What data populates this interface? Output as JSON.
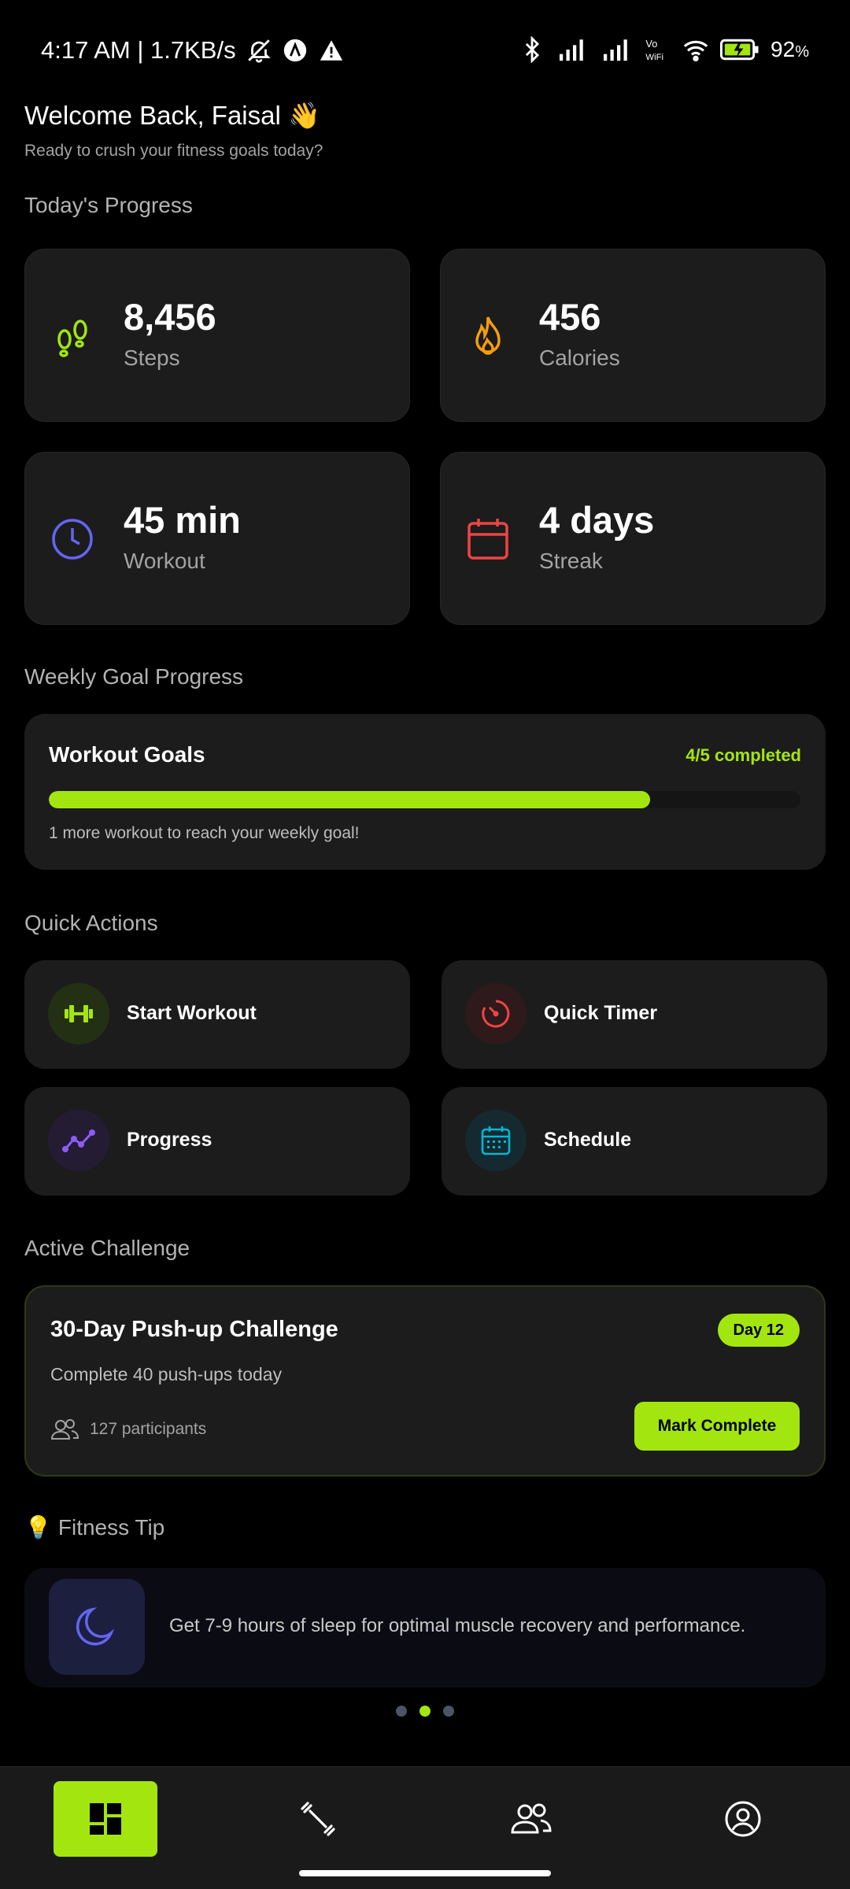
{
  "status_bar": {
    "time_speed": "4:17 AM | 1.7KB/s",
    "battery": "92",
    "battery_unit": "%"
  },
  "greeting": {
    "title": "Welcome Back, Faisal 👋",
    "subtitle": "Ready to crush your fitness goals today?"
  },
  "today": {
    "section_title": "Today's Progress",
    "stats": [
      {
        "value": "8,456",
        "label": "Steps",
        "icon": "footsteps-icon",
        "color": "#a3e60f"
      },
      {
        "value": "456",
        "label": "Calories",
        "icon": "flame-icon",
        "color": "#f59e0b"
      },
      {
        "value": "45 min",
        "label": "Workout",
        "icon": "clock-icon",
        "color": "#6366f1"
      },
      {
        "value": "4 days",
        "label": "Streak",
        "icon": "calendar-icon",
        "color": "#ef4444"
      }
    ]
  },
  "weekly": {
    "section_title": "Weekly Goal Progress",
    "card_title": "Workout Goals",
    "status": "4/5 completed",
    "progress_fraction": 0.8,
    "note": "1 more workout to reach your weekly goal!"
  },
  "quick_actions": {
    "section_title": "Quick Actions",
    "items": [
      {
        "label": "Start Workout",
        "icon": "dumbbell-icon",
        "color": "#a3e60f"
      },
      {
        "label": "Quick Timer",
        "icon": "timer-icon",
        "color": "#ef4444"
      },
      {
        "label": "Progress",
        "icon": "trend-line-icon",
        "color": "#8b5cf6"
      },
      {
        "label": "Schedule",
        "icon": "calendar-icon",
        "color": "#06b6d4"
      }
    ]
  },
  "challenge": {
    "section_title": "Active Challenge",
    "title": "30-Day Push-up Challenge",
    "badge": "Day 12",
    "description": "Complete 40 push-ups today",
    "participants": "127 participants",
    "button": "Mark Complete"
  },
  "tip": {
    "emoji": "💡",
    "section_title": "Fitness Tip",
    "text": "Get 7-9 hours of sleep for optimal muscle recovery and performance.",
    "icon": "moon-icon"
  },
  "pager": {
    "count": 3,
    "active_index": 1
  },
  "bottom_nav": {
    "items": [
      "dashboard-icon",
      "dumbbell-icon",
      "community-icon",
      "profile-icon"
    ],
    "active_index": 0
  },
  "colors": {
    "accent": "#a3e60f",
    "card": "#1c1c1c",
    "background": "#000000"
  }
}
